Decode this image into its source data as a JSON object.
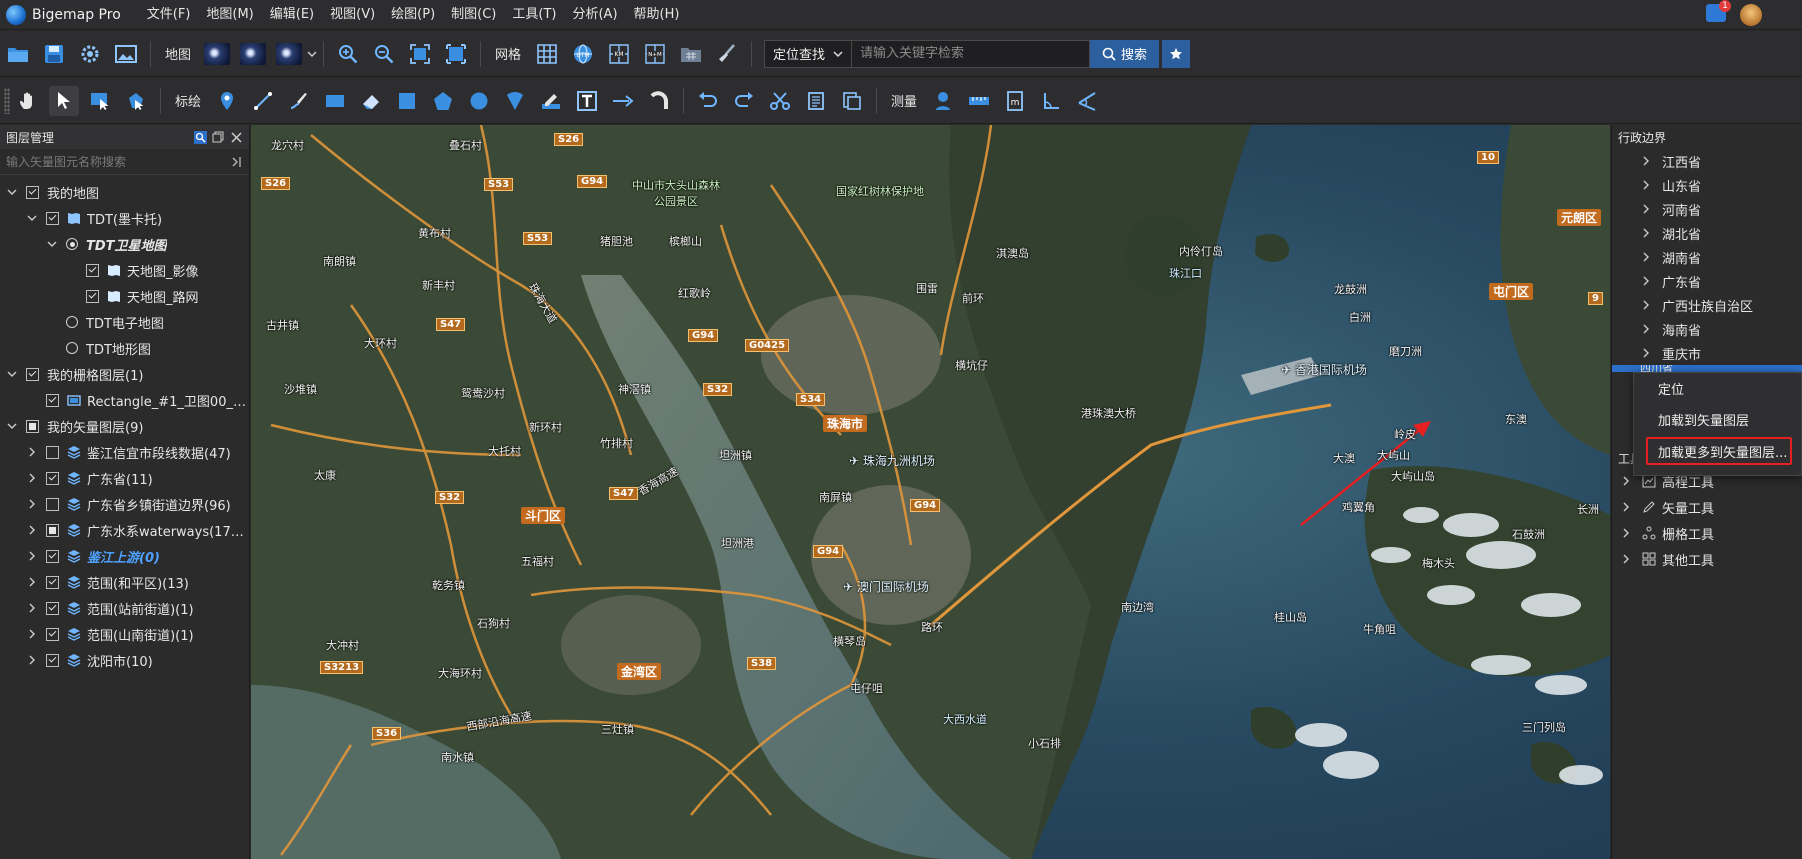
{
  "app": {
    "title": "Bigemap Pro"
  },
  "menu": [
    "文件(F)",
    "地图(M)",
    "编辑(E)",
    "视图(V)",
    "绘图(P)",
    "制图(C)",
    "工具(T)",
    "分析(A)",
    "帮助(H)"
  ],
  "notifications": {
    "count": "1"
  },
  "toolbar1": {
    "map_label": "地图",
    "grid_label": "网格",
    "utm_label": "UTM",
    "km_label": "KM",
    "nm_label": "N+M",
    "search_mode": "定位查找",
    "search_placeholder": "请输入关键字检索",
    "search_button": "搜索"
  },
  "toolbar2": {
    "annotate_label": "标绘",
    "measure_label": "测量"
  },
  "left_panel": {
    "title": "图层管理",
    "search_placeholder": "输入矢量图元名称搜索",
    "tree": [
      {
        "label": "我的地图"
      },
      {
        "label": "TDT(墨卡托)"
      },
      {
        "label": "TDT卫星地图"
      },
      {
        "label": "天地图_影像"
      },
      {
        "label": "天地图_路网"
      },
      {
        "label": "TDT电子地图"
      },
      {
        "label": "TDT地形图"
      },
      {
        "label": "我的栅格图层(1)"
      },
      {
        "label": "Rectangle_#1_卫图00_L..."
      },
      {
        "label": "我的矢量图层(9)"
      },
      {
        "label": "鉴江信宜市段线数据(47)"
      },
      {
        "label": "广东省(11)"
      },
      {
        "label": "广东省乡镇街道边界(96)"
      },
      {
        "label": "广东水系waterways(179..."
      },
      {
        "label": "鉴江上游(0)"
      },
      {
        "label": "范围(和平区)(13)"
      },
      {
        "label": "范围(站前街道)(1)"
      },
      {
        "label": "范围(山南街道)(1)"
      },
      {
        "label": "沈阳市(10)"
      }
    ]
  },
  "map": {
    "labels": {
      "l1": "叠石村",
      "l2": "龙穴村",
      "l3": "中山市大头山森林公园景区",
      "l4": "国家红树林保护地",
      "l5": "淇澳岛",
      "l6": "内伶仃岛",
      "l7": "珠江口",
      "l8": "黄布村",
      "l9": "猪胆池",
      "l10": "槟榔山",
      "l11": "南朗镇",
      "l12": "新丰村",
      "l13": "红歌岭",
      "l14": "围雷",
      "l15": "前环",
      "l16": "古井镇",
      "l17": "大环村",
      "l18": "横坑仔",
      "l19": "沙堆镇",
      "l20": "鸳鸯沙村",
      "l21": "神滘镇",
      "l22": "新环村",
      "l23": "大托村",
      "l24": "竹排村",
      "l25": "坦洲镇",
      "l26": "太康",
      "l27": "南屏镇",
      "l28": "五福村",
      "l29": "乾务镇",
      "l30": "石狗村",
      "l31": "大冲村",
      "l32": "大海环村",
      "l33": "三灶镇",
      "l34": "南水镇",
      "l35": "横琴岛",
      "l36": "屯仔咀",
      "l37": "路环",
      "l38": "南边湾",
      "l39": "大西水道",
      "l40": "小石排",
      "l41": "桂山岛",
      "l42": "牛角咀",
      "l43": "大屿山",
      "l44": "梅木头",
      "l45": "三门列岛",
      "l46": "大澳",
      "l47": "大屿山岛",
      "l48": "岭皮",
      "l49": "长洲",
      "l50": "石鼓洲",
      "l51": "鸡翼角",
      "l52": "磨刀洲",
      "l53": "龙鼓洲",
      "l54": "白洲",
      "l55": "珠海大道",
      "l56": "港珠澳大桥",
      "l57": "坦洲港",
      "l58": "东澳",
      "l59": "香海高速",
      "l60": "西部沿海高速"
    },
    "airports": {
      "a1": "珠海九洲机场",
      "a2": "澳门国际机场",
      "a3": "香港国际机场"
    },
    "districts": {
      "d1": "珠海市",
      "d2": "斗门区",
      "d3": "金湾区",
      "d4": "屯门区",
      "d5": "元朗区"
    },
    "shields": {
      "s1": "S26",
      "s2": "S53",
      "s3": "G94",
      "s4": "S53",
      "s5": "S47",
      "s6": "G94",
      "s7": "G0425",
      "s8": "S32",
      "s9": "S34",
      "s10": "S32",
      "s11": "S47",
      "s12": "G94",
      "s13": "G94",
      "s14": "S3213",
      "s15": "S38",
      "s16": "S36",
      "s17": "S26",
      "s18": "10",
      "s19": "9"
    }
  },
  "right_panel": {
    "title": "行政边界",
    "provinces": [
      "江西省",
      "山东省",
      "河南省",
      "湖北省",
      "湖南省",
      "广东省",
      "广西壮族自治区",
      "海南省",
      "重庆市",
      "四川省"
    ],
    "tools_title": "工具",
    "tools": [
      "高程工具",
      "矢量工具",
      "栅格工具",
      "其他工具"
    ]
  },
  "context_menu": {
    "items": [
      "定位",
      "加载到矢量图层",
      "加载更多到矢量图层..."
    ]
  },
  "colors": {
    "accent": "#2c6fc9",
    "highlight_box": "#e62020",
    "annotation_arrow": "#e62020"
  }
}
